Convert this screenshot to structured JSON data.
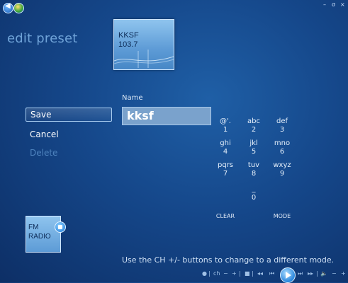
{
  "window": {
    "minimize": "–",
    "maximize": "σ",
    "close": "×"
  },
  "page": {
    "title": "edit preset"
  },
  "station": {
    "line1": "KKSF",
    "line2": "103.7"
  },
  "menu": {
    "save": "Save",
    "cancel": "Cancel",
    "delete": "Delete"
  },
  "name_field": {
    "label": "Name",
    "value": "kksf"
  },
  "keypad": {
    "keys": [
      {
        "letters": "@'.",
        "digit": "1"
      },
      {
        "letters": "abc",
        "digit": "2"
      },
      {
        "letters": "def",
        "digit": "3"
      },
      {
        "letters": "ghi",
        "digit": "4"
      },
      {
        "letters": "jkl",
        "digit": "5"
      },
      {
        "letters": "mno",
        "digit": "6"
      },
      {
        "letters": "pqrs",
        "digit": "7"
      },
      {
        "letters": "tuv",
        "digit": "8"
      },
      {
        "letters": "wxyz",
        "digit": "9"
      },
      {
        "letters": "_",
        "digit": "0"
      }
    ],
    "clear": "CLEAR",
    "mode": "MODE"
  },
  "fm_tile": {
    "line1": "FM",
    "line2": "RADIO"
  },
  "hint": "Use the CH +/- buttons to change to a different mode.",
  "transport": {
    "record": "●",
    "ch": "ch",
    "ch_minus": "−",
    "ch_plus": "+",
    "stop": "■",
    "rewind": "◂◂",
    "prev": "⏮",
    "next": "⏭",
    "fast_forward": "▸▸",
    "volume": "🔈",
    "vol_minus": "−",
    "vol_plus": "+"
  },
  "icons": {
    "back": "back-arrow-icon",
    "logo": "windows-media-center-icon",
    "play": "play-icon"
  }
}
